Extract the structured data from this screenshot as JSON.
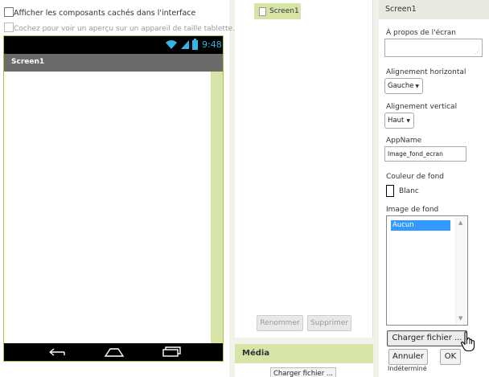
{
  "viewer": {
    "show_hidden_label": "Afficher les composants cachés dans l'interface",
    "tablet_preview_label": "Cochez pour voir un aperçu sur un appareil de taille tablette.",
    "time": "9:48",
    "screen_title": "Screen1"
  },
  "components": {
    "tree_item": "Screen1",
    "rename_button": "Renommer",
    "delete_button": "Supprimer",
    "media_header": "Média",
    "upload_button": "Charger fichier ..."
  },
  "properties": {
    "header": "Screen1",
    "about_label": "À propos de l'écran",
    "about_value": "",
    "align_h_label": "Alignement horizontal",
    "align_h_value": "Gauche",
    "align_v_label": "Alignement vertical",
    "align_v_value": "Haut",
    "appname_label": "AppName",
    "appname_value": "Image_fond_ecran",
    "bgcolor_label": "Couleur de fond",
    "bgcolor_value": "Blanc",
    "bgimage_label": "Image de fond",
    "bgimage_selected": "Aucun",
    "upload_button": "Charger fichier ...",
    "cancel_button": "Annuler",
    "ok_button": "OK",
    "partial_text": "Indéterminé"
  },
  "colors": {
    "accent_green": "#d7e4a7",
    "selection_blue": "#3399ff",
    "wifi_teal": "#33b5e5"
  }
}
